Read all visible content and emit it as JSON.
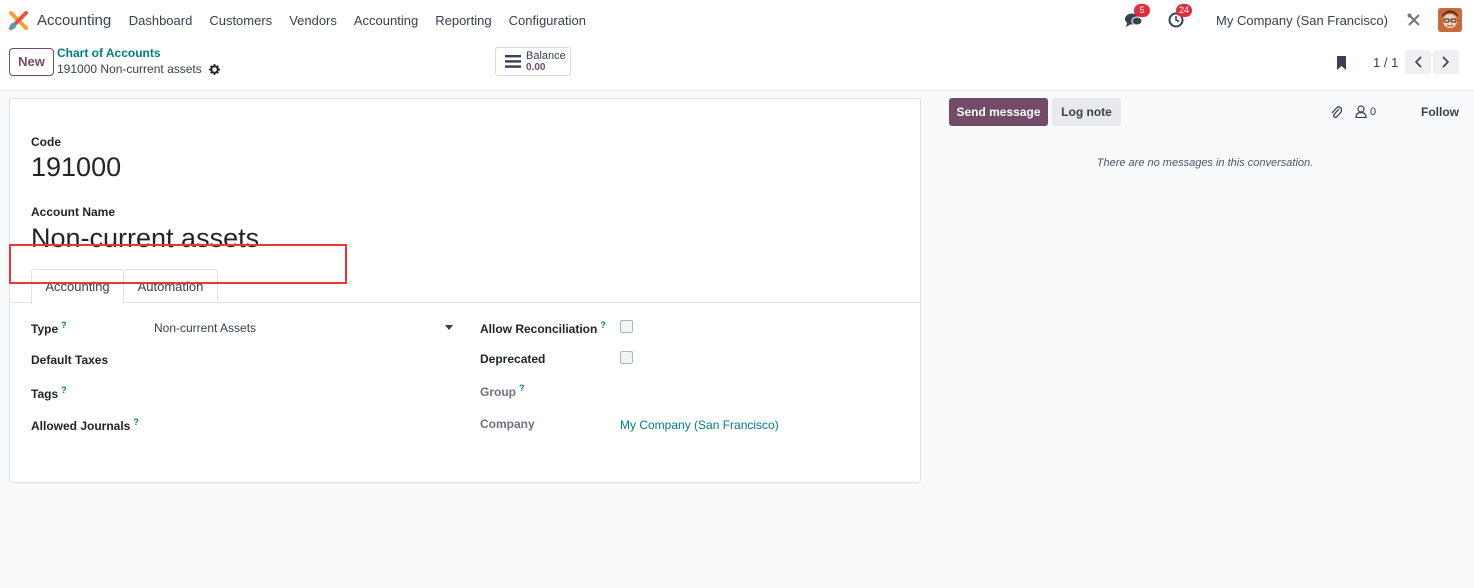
{
  "navbar": {
    "app_name": "Accounting",
    "menu": [
      "Dashboard",
      "Customers",
      "Vendors",
      "Accounting",
      "Reporting",
      "Configuration"
    ],
    "messages_badge": "5",
    "activities_badge": "24",
    "company": "My Company (San Francisco)",
    "icons": [
      "accounting-app-logo",
      "chat-bubbles-icon",
      "clock-icon",
      "debug-tools-icon",
      "user-avatar"
    ]
  },
  "control_panel": {
    "new_label": "New",
    "breadcrumb_parent": "Chart of Accounts",
    "breadcrumb_current": "191000 Non-current assets",
    "balance_label": "Balance",
    "balance_value": "0.00",
    "pager": "1 / 1"
  },
  "form": {
    "code_label": "Code",
    "code_value": "191000",
    "name_label": "Account Name",
    "name_value": "Non-current assets",
    "tabs": [
      "Accounting",
      "Automation"
    ],
    "type_label": "Type",
    "type_value": "Non-current Assets",
    "default_taxes_label": "Default Taxes",
    "tags_label": "Tags",
    "allowed_journals_label": "Allowed Journals",
    "allow_reconciliation_label": "Allow Reconciliation",
    "deprecated_label": "Deprecated",
    "group_label": "Group",
    "company_label": "Company",
    "company_value": "My Company (San Francisco)",
    "help_mark": "?"
  },
  "chatter": {
    "send_message": "Send message",
    "log_note": "Log note",
    "followers_count": "0",
    "follow": "Follow",
    "empty_text": "There are no messages in this conversation."
  },
  "colors": {
    "brand": "#714b67",
    "link": "#017e84",
    "badge": "#e02d3c",
    "highlight": "#e53935"
  }
}
